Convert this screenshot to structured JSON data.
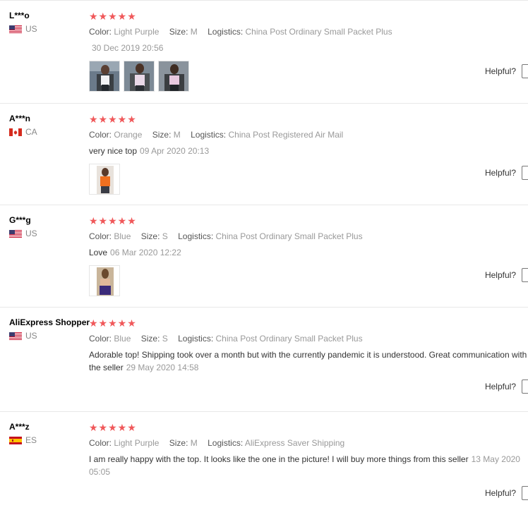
{
  "labels": {
    "color": "Color:",
    "size": "Size:",
    "logistics": "Logistics:",
    "helpful": "Helpful?"
  },
  "star_color": "#f0585a",
  "reviews": [
    {
      "user": "L***o",
      "country": "US",
      "flag": "us-flag-icon",
      "stars": "★★★★★",
      "color": "Light Purple",
      "size": "M",
      "logistics": "China Post Ordinary Small Packet Plus",
      "text": "",
      "date": "30 Dec 2019 20:56",
      "photos": [
        "review-photo-purple-top-1",
        "review-photo-purple-top-2",
        "review-photo-purple-top-3"
      ]
    },
    {
      "user": "A***n",
      "country": "CA",
      "flag": "ca-flag-icon",
      "stars": "★★★★★",
      "color": "Orange",
      "size": "M",
      "logistics": "China Post Registered Air Mail",
      "text": "very nice top",
      "date": "09 Apr 2020 20:13",
      "photos": [
        "review-photo-orange-top"
      ]
    },
    {
      "user": "G***g",
      "country": "US",
      "flag": "us-flag-icon",
      "stars": "★★★★★",
      "color": "Blue",
      "size": "S",
      "logistics": "China Post Ordinary Small Packet Plus",
      "text": "Love",
      "date": "06 Mar 2020 12:22",
      "photos": [
        "review-photo-blue-top"
      ]
    },
    {
      "user": "AliExpress Shopper",
      "country": "US",
      "flag": "us-flag-icon",
      "stars": "★★★★★",
      "color": "Blue",
      "size": "S",
      "logistics": "China Post Ordinary Small Packet Plus",
      "text": "Adorable top! Shipping took over a month but with the currently pandemic it is understood. Great communication with the seller",
      "date": "29 May 2020 14:58",
      "photos": []
    },
    {
      "user": "A***z",
      "country": "ES",
      "flag": "es-flag-icon",
      "stars": "★★★★★",
      "color": "Light Purple",
      "size": "M",
      "logistics": "AliExpress Saver Shipping",
      "text": "I am really happy with the top. It looks like the one in the picture! I will buy more things from this seller",
      "date": "13 May 2020 05:05",
      "photos": []
    }
  ]
}
